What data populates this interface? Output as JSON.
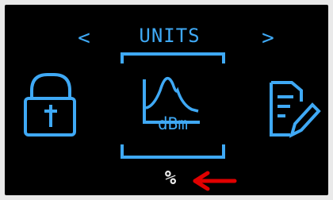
{
  "menu": {
    "title": "UNITS",
    "nav_left": "<",
    "nav_right": ">",
    "selected_icon_label": "dBm",
    "selected_unit": "%"
  },
  "icons": {
    "left": "padlock-icon",
    "center": "spectrum-dbm-icon",
    "right": "clipboard-edit-icon",
    "pointer": "arrow-left-icon"
  },
  "colors": {
    "screen": "#000000",
    "accent": "#3fa9f5",
    "value": "#e9e9e9",
    "pointer": "#e00000"
  }
}
